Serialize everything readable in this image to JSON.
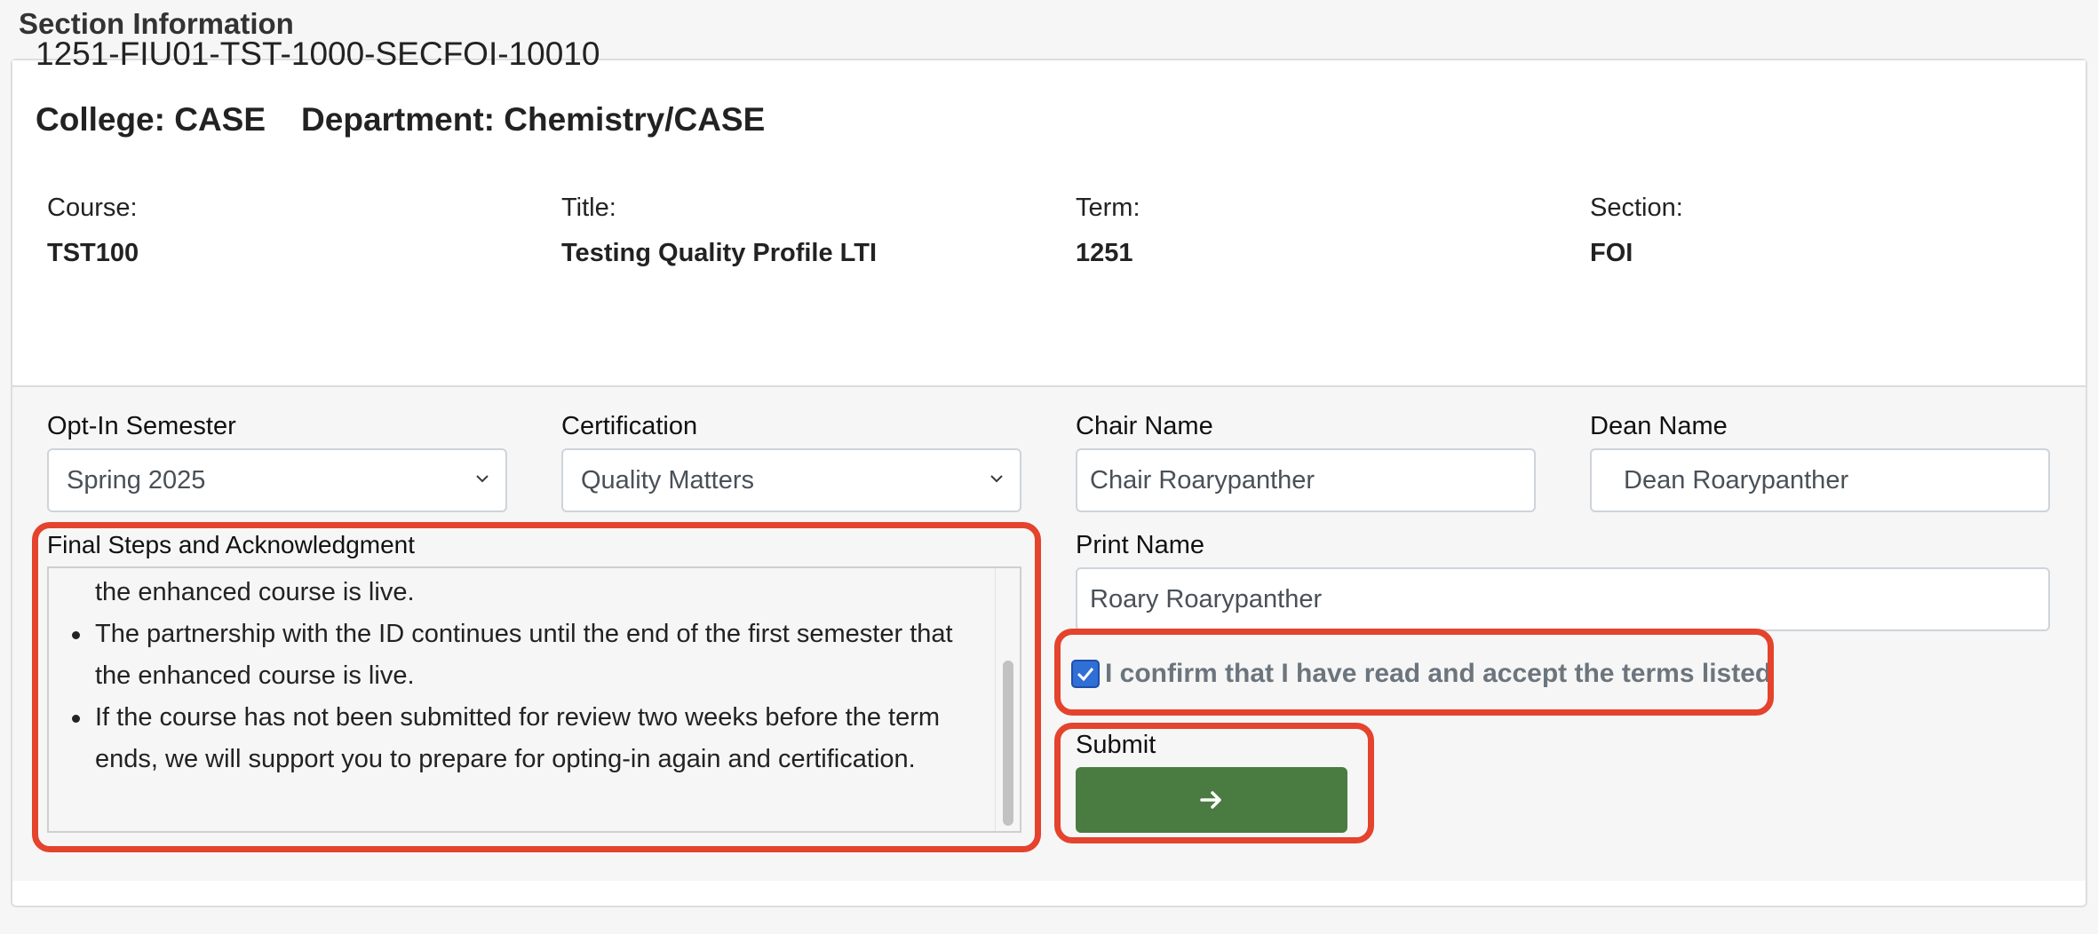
{
  "section_heading": "Section Information",
  "section_id": "1251-FIU01-TST-1000-SECFOI-10010",
  "college": "College: CASE",
  "department": "Department: Chemistry/CASE",
  "info": {
    "course_label": "Course:",
    "course_value": "TST100",
    "title_label": "Title:",
    "title_value": "Testing Quality Profile LTI",
    "term_label": "Term:",
    "term_value": "1251",
    "section_label": "Section:",
    "section_value": "FOI"
  },
  "form": {
    "opt_in_label": "Opt-In Semester",
    "opt_in_value": "Spring 2025",
    "certification_label": "Certification",
    "certification_value": "Quality Matters",
    "chair_label": "Chair Name",
    "chair_value": "Chair Roarypanther",
    "dean_label": "Dean Name",
    "dean_value": "Dean Roarypanther",
    "print_name_label": "Print Name",
    "print_name_value": "Roary Roarypanther",
    "ack_label": "Final Steps and Acknowledgment",
    "ack_lines": {
      "line0": "the enhanced course is live.",
      "bullet1": "The partnership with the ID continues until the end of the first semester that",
      "bullet1_cont": "the enhanced course is live.",
      "bullet2": "If the course has not been submitted for review two weeks before the term",
      "bullet2_cont": "ends, we will support you to prepare for opting-in again and certification."
    },
    "confirm_text": "I confirm that I have read and accept the terms listed",
    "confirm_checked": true,
    "submit_label": "Submit",
    "submit_icon": "arrow-right-icon"
  },
  "colors": {
    "submit_bg": "#4a7c42",
    "highlight": "#e4432d",
    "checkbox": "#2f6fd6"
  }
}
